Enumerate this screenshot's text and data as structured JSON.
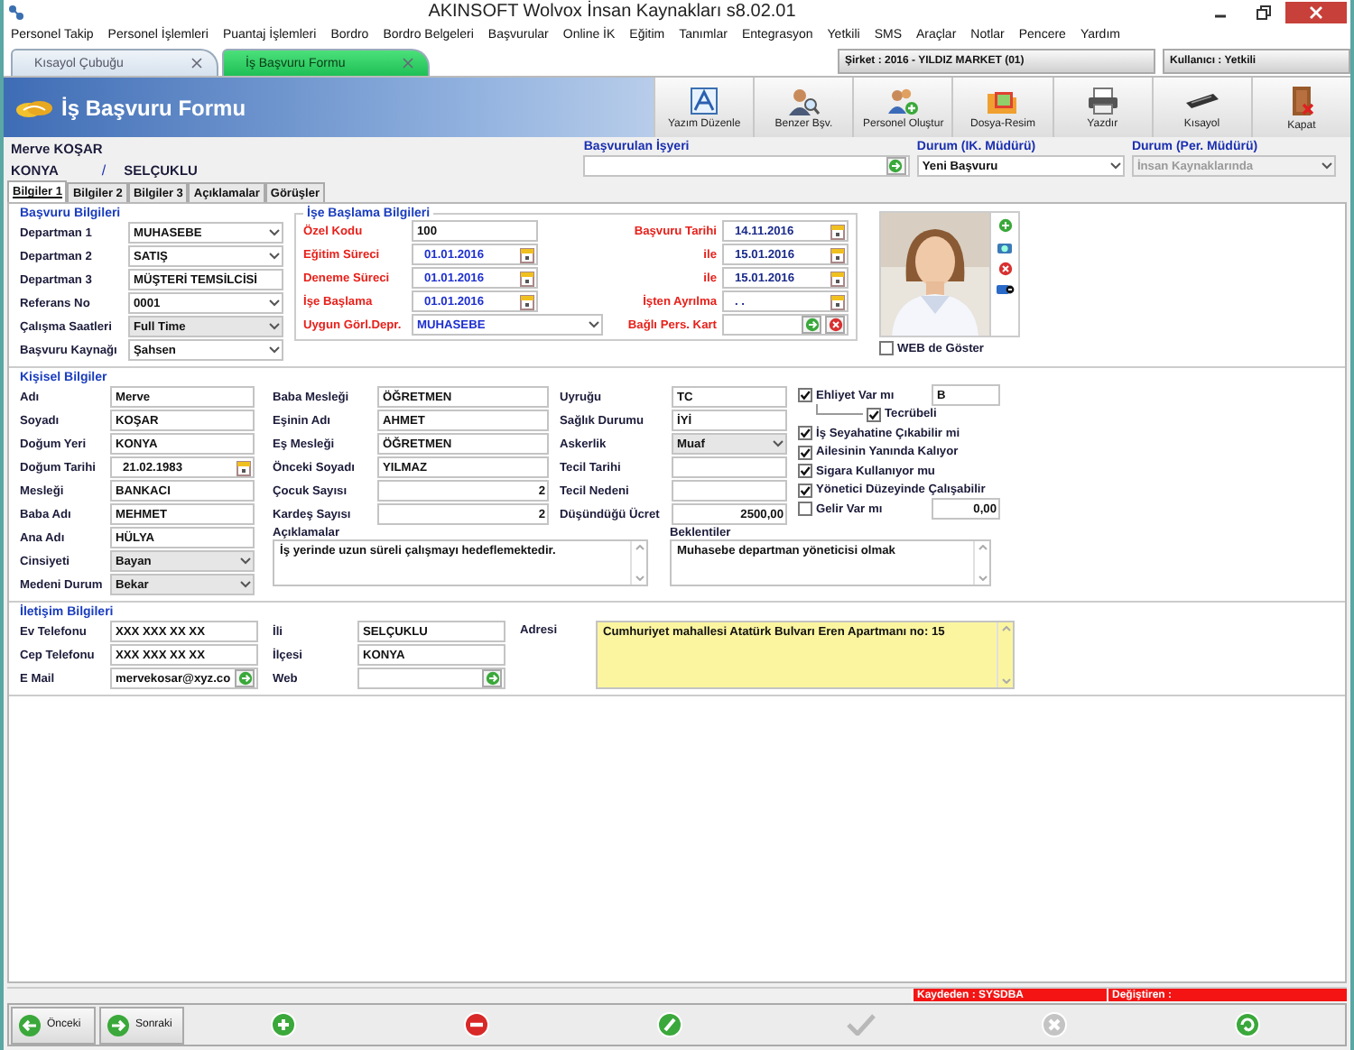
{
  "window": {
    "title": "AKINSOFT Wolvox İnsan Kaynakları s8.02.01"
  },
  "menu": [
    "Personel Takip",
    "Personel İşlemleri",
    "Puantaj İşlemleri",
    "Bordro",
    "Bordro Belgeleri",
    "Başvurular",
    "Online İK",
    "Eğitim",
    "Tanımlar",
    "Entegrasyon",
    "Yetkili",
    "SMS",
    "Araçlar",
    "Notlar",
    "Pencere",
    "Yardım"
  ],
  "doc_tabs": [
    {
      "label": "Kısayol Çubuğu",
      "selected": false
    },
    {
      "label": "İş Başvuru Formu",
      "selected": true
    }
  ],
  "company": "Şirket : 2016 - YILDIZ MARKET (01)",
  "user": "Kullanıcı : Yetkili",
  "form_title": "İş Başvuru Formu",
  "toolbar": [
    {
      "label": "Yazım Düzenle",
      "kind": "edit"
    },
    {
      "label": "Benzer Bşv.",
      "kind": "similar"
    },
    {
      "label": "Personel Oluştur",
      "kind": "create"
    },
    {
      "label": "Dosya-Resim",
      "kind": "file"
    },
    {
      "label": "Yazdır",
      "kind": "print"
    },
    {
      "label": "Kısayol",
      "kind": "shortcut"
    },
    {
      "label": "Kapat",
      "kind": "close"
    }
  ],
  "applicant": {
    "name": "Merve KOŞAR",
    "city": "KONYA",
    "separator": "/",
    "district": "SELÇUKLU"
  },
  "workplace": {
    "label": "Başvurulan İşyeri"
  },
  "status_hr": {
    "label": "Durum (IK. Müdürü)",
    "value": "Yeni Başvuru",
    "disabled": false
  },
  "status_manager": {
    "label": "Durum (Per. Müdürü)",
    "value": "İnsan Kaynaklarında",
    "disabled": true
  },
  "sub_tabs": [
    {
      "label": "Bilgiler 1",
      "selected": true
    },
    {
      "label": "Bilgiler 2",
      "selected": false
    },
    {
      "label": "Bilgiler 3",
      "selected": false
    },
    {
      "label": "Açıklamalar",
      "selected": false
    },
    {
      "label": "Görüşler",
      "selected": false
    }
  ],
  "application": {
    "title": "Başvuru Bilgileri",
    "fields": [
      {
        "label": "Departman 1",
        "value": "MUHASEBE",
        "kind": "select"
      },
      {
        "label": "Departman 2",
        "value": "SATIŞ",
        "kind": "select"
      },
      {
        "label": "Departman 3",
        "value": "MÜŞTERİ TEMSİLCİSİ",
        "kind": "text"
      },
      {
        "label": "Referans No",
        "value": "0001",
        "kind": "select"
      },
      {
        "label": "Çalışma Saatleri",
        "value": "Full Time",
        "kind": "combo"
      },
      {
        "label": "Başvuru Kaynağı",
        "value": "Şahsen",
        "kind": "select"
      }
    ]
  },
  "start": {
    "title": "İşe Başlama Bilgileri",
    "left": [
      {
        "label": "Özel Kodu",
        "value": "100",
        "kind": "text"
      },
      {
        "label": "Eğitim Süreci",
        "value": "01.01.2016",
        "kind": "date"
      },
      {
        "label": "Deneme Süreci",
        "value": "01.01.2016",
        "kind": "date"
      },
      {
        "label": "İşe Başlama",
        "value": "01.01.2016",
        "kind": "date"
      },
      {
        "label": "Uygun Görl.Depr.",
        "value": "MUHASEBE",
        "kind": "select"
      }
    ],
    "right": [
      {
        "label": "Başvuru Tarihi",
        "value": "14.11.2016",
        "kind": "date"
      },
      {
        "label": "ile",
        "value": "15.01.2016",
        "kind": "date"
      },
      {
        "label": "ile",
        "value": "15.01.2016",
        "kind": "date"
      },
      {
        "label": "İşten Ayrılma",
        "value": ". .",
        "kind": "date"
      },
      {
        "label": "Bağlı Pers. Kart",
        "kind": "pick"
      }
    ]
  },
  "web_show": {
    "label": "WEB de Göster",
    "checked": false
  },
  "personal": {
    "title": "Kişisel Bilgiler",
    "col1": [
      {
        "label": "Adı",
        "value": "Merve",
        "kind": "text"
      },
      {
        "label": "Soyadı",
        "value": "KOŞAR",
        "kind": "text"
      },
      {
        "label": "Doğum Yeri",
        "value": "KONYA",
        "kind": "text"
      },
      {
        "label": "Doğum Tarihi",
        "value": "21.02.1983",
        "kind": "date"
      },
      {
        "label": "Mesleği",
        "value": "BANKACI",
        "kind": "text"
      },
      {
        "label": "Baba Adı",
        "value": "MEHMET",
        "kind": "text"
      },
      {
        "label": "Ana Adı",
        "value": "HÜLYA",
        "kind": "text"
      },
      {
        "label": "Cinsiyeti",
        "value": "Bayan",
        "kind": "combo"
      },
      {
        "label": "Medeni Durum",
        "value": "Bekar",
        "kind": "combo"
      }
    ],
    "col2": [
      {
        "label": "Baba Mesleği",
        "value": "ÖĞRETMEN",
        "kind": "text"
      },
      {
        "label": "Eşinin Adı",
        "value": "AHMET",
        "kind": "text"
      },
      {
        "label": "Eş Mesleği",
        "value": "ÖĞRETMEN",
        "kind": "text"
      },
      {
        "label": "Önceki Soyadı",
        "value": "YILMAZ",
        "kind": "text"
      },
      {
        "label": "Çocuk Sayısı",
        "value": "2",
        "kind": "number"
      },
      {
        "label": "Kardeş Sayısı",
        "value": "2",
        "kind": "number"
      }
    ],
    "col3": [
      {
        "label": "Uyruğu",
        "value": "TC",
        "kind": "text"
      },
      {
        "label": "Sağlık Durumu",
        "value": "İYİ",
        "kind": "text"
      },
      {
        "label": "Askerlik",
        "value": "Muaf",
        "kind": "combo"
      },
      {
        "label": "Tecil Tarihi",
        "kind": "text"
      },
      {
        "label": "Tecil Nedeni",
        "kind": "text"
      },
      {
        "label": "Düşündüğü Ücret",
        "value": "2500,00",
        "kind": "number"
      }
    ],
    "options": [
      {
        "label": "Ehliyet Var mı",
        "checked": true,
        "value": "B",
        "children": [
          {
            "label": "Tecrübeli",
            "checked": true
          }
        ]
      },
      {
        "label": "İş Seyahatine Çıkabilir mi",
        "checked": true
      },
      {
        "label": "Ailesinin Yanında Kalıyor",
        "checked": true
      },
      {
        "label": "Sigara Kullanıyor mu",
        "checked": true
      },
      {
        "label": "Yönetici Düzeyinde Çalışabilir",
        "checked": true
      },
      {
        "label": "Gelir Var mı",
        "checked": false,
        "value": "0,00"
      }
    ],
    "notes": [
      {
        "label": "Açıklamalar",
        "value": "İş yerinde uzun süreli çalışmayı hedeflemektedir."
      },
      {
        "label": "Beklentiler",
        "value": "Muhasebe departman yöneticisi olmak"
      }
    ]
  },
  "contact": {
    "title": "İletişim Bilgileri",
    "col1": [
      {
        "label": "Ev Telefonu",
        "value": "XXX XXX XX XX",
        "kind": "text"
      },
      {
        "label": "Cep Telefonu",
        "value": "XXX XXX XX XX",
        "kind": "text"
      },
      {
        "label": "E Mail",
        "value": "mervekosar@xyz.co",
        "kind": "lookup"
      }
    ],
    "col2": [
      {
        "label": "İli",
        "value": "SELÇUKLU",
        "kind": "text"
      },
      {
        "label": "İlçesi",
        "value": "KONYA",
        "kind": "text"
      },
      {
        "label": "Web",
        "kind": "lookup"
      }
    ],
    "address": {
      "label": "Adresi",
      "value": "Cumhuriyet mahallesi Atatürk Bulvarı Eren Apartmanı no: 15"
    }
  },
  "record": {
    "created_by": "Kaydeden : SYSDBA",
    "modified_by": "Değiştiren :"
  },
  "nav": [
    {
      "label": "Önceki",
      "kind": "prev"
    },
    {
      "label": "Sonraki",
      "kind": "next"
    }
  ],
  "actions": [
    {
      "kind": "add",
      "disabled": false
    },
    {
      "kind": "delete",
      "disabled": false
    },
    {
      "kind": "edit",
      "disabled": false
    },
    {
      "kind": "save",
      "disabled": true
    },
    {
      "kind": "cancel",
      "disabled": true
    },
    {
      "kind": "refresh",
      "disabled": false
    }
  ]
}
